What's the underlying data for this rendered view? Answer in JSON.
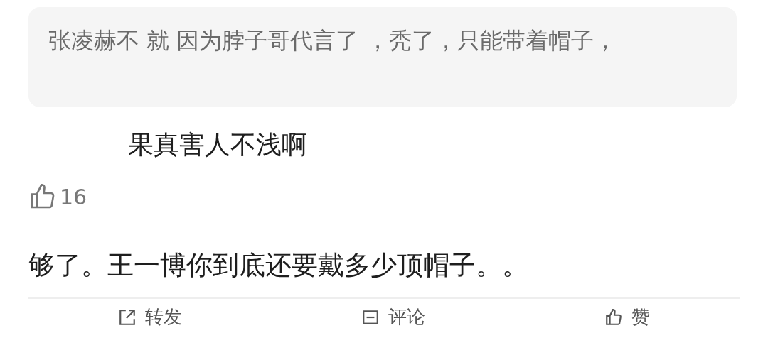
{
  "quote": {
    "text": "张凌赫不 就 因为脖子哥代言了 ，秃了，只能带着帽子，"
  },
  "comment": {
    "text": "果真害人不浅啊",
    "likes": "16"
  },
  "reply": {
    "text": "够了。王一博你到底还要戴多少顶帽子。。"
  },
  "actions": [
    {
      "kind": "share",
      "label": "转发"
    },
    {
      "kind": "comment",
      "label": "评论"
    },
    {
      "kind": "like",
      "label": "赞"
    }
  ]
}
